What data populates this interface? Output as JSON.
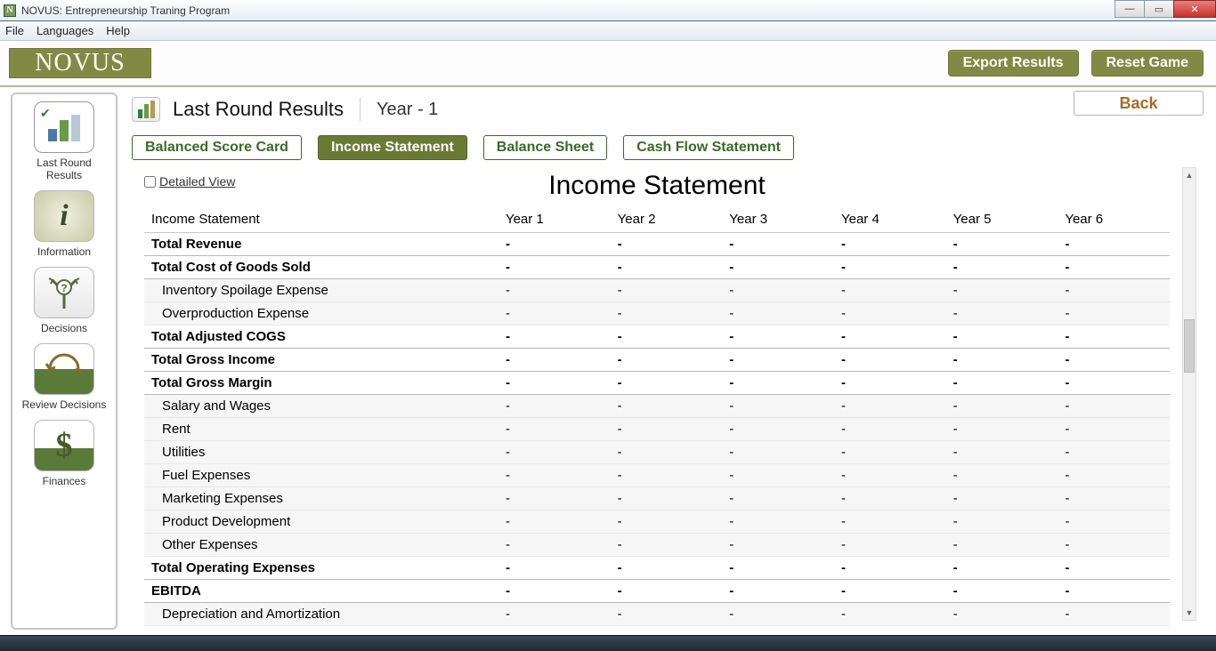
{
  "window": {
    "title": "NOVUS: Entrepreneurship Traning Program"
  },
  "menu": {
    "file": "File",
    "languages": "Languages",
    "help": "Help"
  },
  "brand": "NOVUS",
  "top_buttons": {
    "export": "Export Results",
    "reset": "Reset Game"
  },
  "back_label": "Back",
  "page": {
    "title": "Last Round Results",
    "subtitle": "Year - 1"
  },
  "tabs": {
    "bsc": "Balanced Score Card",
    "is": "Income Statement",
    "bs": "Balance Sheet",
    "cf": "Cash Flow Statement"
  },
  "sidebar": {
    "items": [
      {
        "label": "Last Round Results"
      },
      {
        "label": "Information"
      },
      {
        "label": "Decisions"
      },
      {
        "label": "Review Decisions"
      },
      {
        "label": "Finances"
      }
    ]
  },
  "report": {
    "detailed_view_label": "Detailed View",
    "title": "Income Statement",
    "header_label": "Income Statement",
    "columns": [
      "Year 1",
      "Year 2",
      "Year 3",
      "Year 4",
      "Year 5",
      "Year 6"
    ],
    "rows": [
      {
        "label": "Total Revenue",
        "type": "total",
        "values": [
          "-",
          "-",
          "-",
          "-",
          "-",
          "-"
        ]
      },
      {
        "label": "Total Cost of Goods Sold",
        "type": "total",
        "values": [
          "-",
          "-",
          "-",
          "-",
          "-",
          "-"
        ]
      },
      {
        "label": "Inventory Spoilage Expense",
        "type": "sub",
        "values": [
          "-",
          "-",
          "-",
          "-",
          "-",
          "-"
        ]
      },
      {
        "label": "Overproduction Expense",
        "type": "sub",
        "values": [
          "-",
          "-",
          "-",
          "-",
          "-",
          "-"
        ]
      },
      {
        "label": "Total Adjusted COGS",
        "type": "total",
        "values": [
          "-",
          "-",
          "-",
          "-",
          "-",
          "-"
        ]
      },
      {
        "label": "Total Gross Income",
        "type": "total",
        "values": [
          "-",
          "-",
          "-",
          "-",
          "-",
          "-"
        ]
      },
      {
        "label": "Total Gross Margin",
        "type": "total",
        "values": [
          "-",
          "-",
          "-",
          "-",
          "-",
          "-"
        ]
      },
      {
        "label": "Salary and Wages",
        "type": "sub",
        "values": [
          "-",
          "-",
          "-",
          "-",
          "-",
          "-"
        ]
      },
      {
        "label": "Rent",
        "type": "sub",
        "values": [
          "-",
          "-",
          "-",
          "-",
          "-",
          "-"
        ]
      },
      {
        "label": "Utilities",
        "type": "sub",
        "values": [
          "-",
          "-",
          "-",
          "-",
          "-",
          "-"
        ]
      },
      {
        "label": "Fuel Expenses",
        "type": "sub",
        "values": [
          "-",
          "-",
          "-",
          "-",
          "-",
          "-"
        ]
      },
      {
        "label": "Marketing Expenses",
        "type": "sub",
        "values": [
          "-",
          "-",
          "-",
          "-",
          "-",
          "-"
        ]
      },
      {
        "label": "Product Development",
        "type": "sub",
        "values": [
          "-",
          "-",
          "-",
          "-",
          "-",
          "-"
        ]
      },
      {
        "label": "Other Expenses",
        "type": "sub",
        "values": [
          "-",
          "-",
          "-",
          "-",
          "-",
          "-"
        ]
      },
      {
        "label": "Total Operating Expenses",
        "type": "total",
        "values": [
          "-",
          "-",
          "-",
          "-",
          "-",
          "-"
        ]
      },
      {
        "label": "EBITDA",
        "type": "total",
        "values": [
          "-",
          "-",
          "-",
          "-",
          "-",
          "-"
        ]
      },
      {
        "label": "Depreciation and Amortization",
        "type": "sub",
        "values": [
          "-",
          "-",
          "-",
          "-",
          "-",
          "-"
        ]
      }
    ]
  }
}
